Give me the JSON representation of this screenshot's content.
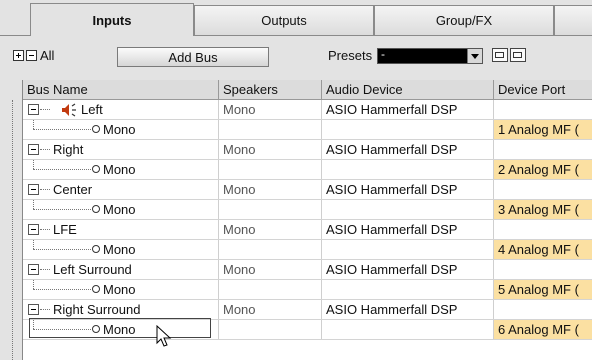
{
  "tabs": [
    {
      "label": "Inputs",
      "active": true
    },
    {
      "label": "Outputs",
      "active": false
    },
    {
      "label": "Group/FX",
      "active": false
    }
  ],
  "toolbar": {
    "all_label": "All",
    "add_bus_label": "Add Bus",
    "presets_label": "Presets",
    "presets_value": "-"
  },
  "table": {
    "columns": [
      "Bus Name",
      "Speakers",
      "Audio Device",
      "Device Port"
    ],
    "rows": [
      {
        "kind": "bus",
        "name": "Left",
        "speakers": "Mono",
        "device": "ASIO Hammerfall DSP",
        "port": ""
      },
      {
        "kind": "channel",
        "name": "Mono",
        "speakers": "",
        "device": "",
        "port": "1 Analog MF ("
      },
      {
        "kind": "bus",
        "name": "Right",
        "speakers": "Mono",
        "device": "ASIO Hammerfall DSP",
        "port": ""
      },
      {
        "kind": "channel",
        "name": "Mono",
        "speakers": "",
        "device": "",
        "port": "2 Analog MF ("
      },
      {
        "kind": "bus",
        "name": "Center",
        "speakers": "Mono",
        "device": "ASIO Hammerfall DSP",
        "port": ""
      },
      {
        "kind": "channel",
        "name": "Mono",
        "speakers": "",
        "device": "",
        "port": "3 Analog MF ("
      },
      {
        "kind": "bus",
        "name": "LFE",
        "speakers": "Mono",
        "device": "ASIO Hammerfall DSP",
        "port": ""
      },
      {
        "kind": "channel",
        "name": "Mono",
        "speakers": "",
        "device": "",
        "port": "4 Analog MF ("
      },
      {
        "kind": "bus",
        "name": "Left Surround",
        "speakers": "Mono",
        "device": "ASIO Hammerfall DSP",
        "port": ""
      },
      {
        "kind": "channel",
        "name": "Mono",
        "speakers": "",
        "device": "",
        "port": "5 Analog MF ("
      },
      {
        "kind": "bus",
        "name": "Right Surround",
        "speakers": "Mono",
        "device": "ASIO Hammerfall DSP",
        "port": ""
      },
      {
        "kind": "channel",
        "name": "Mono",
        "speakers": "",
        "device": "",
        "port": "6 Analog MF ("
      }
    ]
  },
  "colors": {
    "port_highlight": "#fbe0a2"
  },
  "icons": {
    "speaker": "speaker-icon",
    "expand": "expand-all-icon",
    "collapse": "collapse-all-icon"
  }
}
